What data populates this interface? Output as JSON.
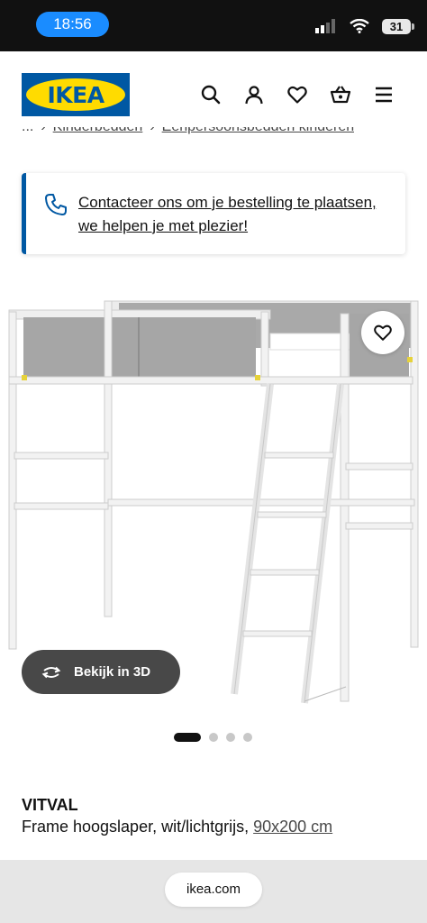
{
  "status_bar": {
    "time": "18:56",
    "battery": "31"
  },
  "header": {
    "logo_text": "IKEA",
    "icons": [
      "search-icon",
      "user-icon",
      "heart-icon",
      "basket-icon",
      "menu-icon"
    ]
  },
  "breadcrumb": {
    "ellipsis": "...",
    "items": [
      "Kinderbedden",
      "Eenpersoonsbedden kinderen"
    ]
  },
  "contact_banner": {
    "text": "Contacteer ons om je bestelling te plaatsen, we helpen je met plezier!"
  },
  "gallery": {
    "view3d_label": "Bekijk in 3D",
    "dot_count": 4,
    "active_index": 0
  },
  "product": {
    "name": "VITVAL",
    "description": "Frame hoogslaper, wit/lichtgrijs, ",
    "size": "90x200 cm"
  },
  "browser": {
    "url": "ikea.com"
  },
  "colors": {
    "brand_blue": "#0058a3",
    "brand_yellow": "#ffdb00",
    "dark_button": "#484848"
  }
}
